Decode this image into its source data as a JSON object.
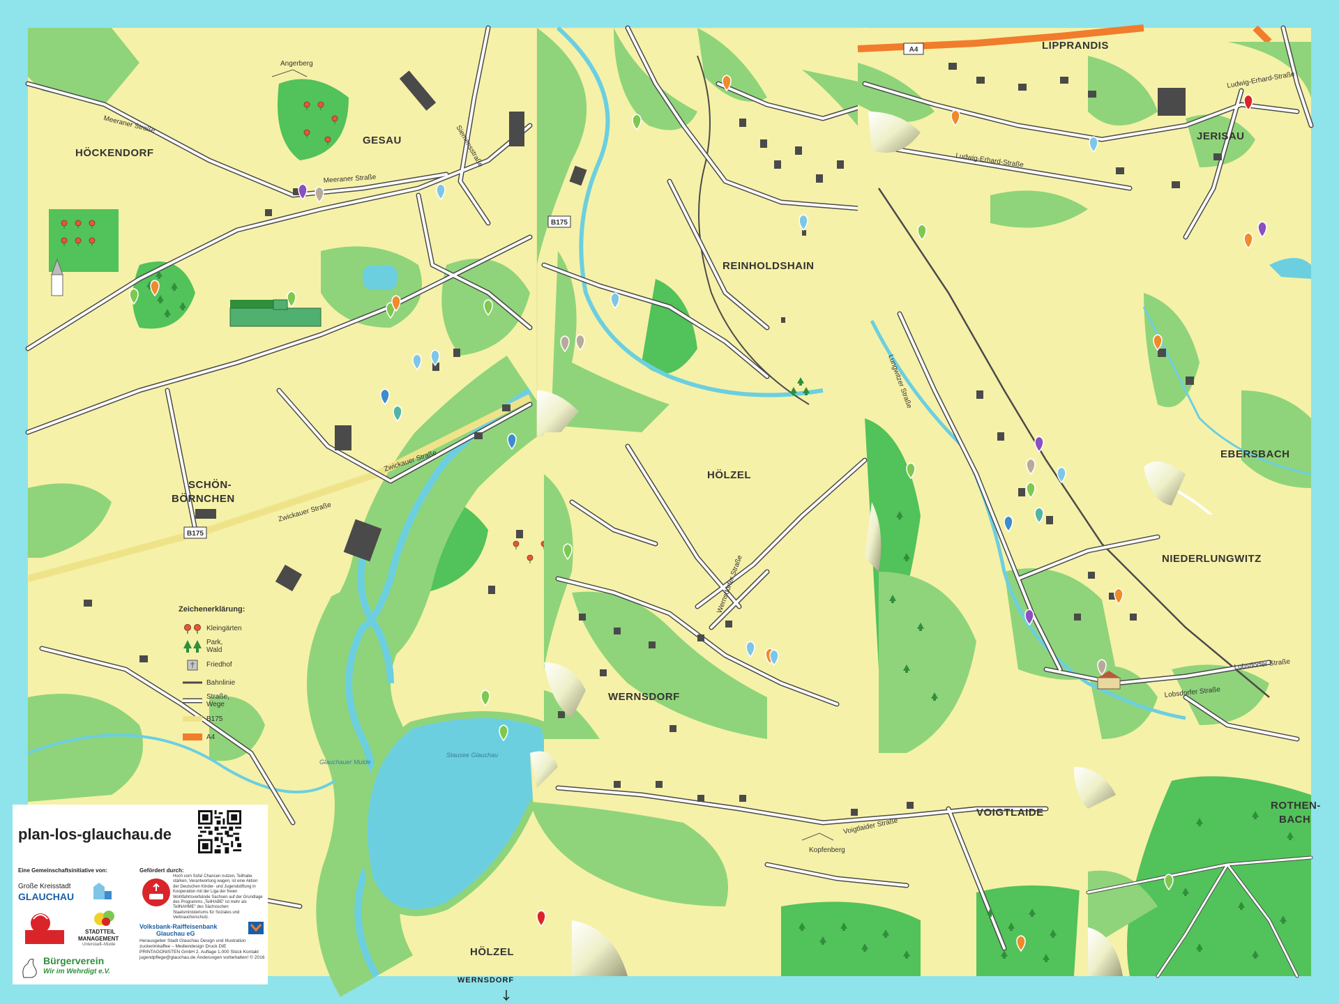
{
  "colors": {
    "frame": "#8fe3ea",
    "land": "#f6f1a8",
    "green": "#8fd47a",
    "forest": "#52c25a",
    "water": "#6ccfe0",
    "road": "#ffffff",
    "b175": "#efe38a",
    "a4": "#f07c2c",
    "building": "#4a4a4a",
    "pin_green": "#7ec850",
    "pin_orange": "#f08a2a",
    "pin_blue": "#7ec6e6",
    "pin_purple": "#8a4fc0",
    "pin_red": "#d9252a",
    "pin_grey": "#b8aa9a"
  },
  "places": {
    "hoeckendorf": "HÖCKENDORF",
    "gesau": "GESAU",
    "schoenboernchen_1": "SCHÖN-",
    "schoenboernchen_2": "BÖRNCHEN",
    "reinholdshain": "REINHOLDSHAIN",
    "hoelzel_n": "HÖLZEL",
    "wernsdorf": "WERNSDORF",
    "lipprandis": "LIPPRANDIS",
    "jerisau": "JERISAU",
    "ebersbach": "EBERSBACH",
    "niederlungwitz": "NIEDERLUNGWITZ",
    "voigtlaide": "VOIGTLAIDE",
    "rothenbach_1": "ROTHEN-",
    "rothenbach_2": "BACH",
    "hoelzel_s": "HÖLZEL",
    "wernsdorf_arrow": "WERNSDORF"
  },
  "streets": {
    "meeraner_strasse": "Meeraner Straße",
    "meeraner_strasse_2": "Meeraner Straße",
    "siemensstrasse": "Siemensstraße",
    "zwickauer_strasse": "Zwickauer Straße",
    "zwickauer_strasse_2": "Zwickauer Straße",
    "wernsdorfer_strasse": "Wernsdorfer Straße",
    "voigtlaider_strasse": "Voigtlaider Straße",
    "lobsdorfer_strasse": "Lobsdorfer Straße",
    "lobsdorfer_strasse_2": "Lobsdorfer Straße",
    "ludwig_erhard_strasse": "Ludwig-Erhard-Straße",
    "ludwig_erhard_strasse_2": "Ludwig-Erhard-Straße",
    "lungwitzer_strasse": "Lungwitzer Straße",
    "b175": "B175",
    "b175_2": "B175",
    "a4": "A4",
    "angerberg": "Angerberg",
    "kopfenberg": "Kopfenberg",
    "stausee": "Stausee Glauchau",
    "mulde": "Glauchauer Mulde"
  },
  "legend": {
    "title": "Zeichenerklärung:",
    "items": [
      {
        "label1": "Kleingärten",
        "label2": ""
      },
      {
        "label1": "Park,",
        "label2": "Wald"
      },
      {
        "label1": "Friedhof",
        "label2": ""
      },
      {
        "label1": "Bahnlinie",
        "label2": ""
      },
      {
        "label1": "Straße,",
        "label2": "Wege"
      },
      {
        "label1": "B175",
        "label2": ""
      },
      {
        "label1": "A4",
        "label2": ""
      }
    ]
  },
  "info": {
    "url": "plan-los-glauchau.de",
    "initiative_label": "Eine Gemeinschaftsinitiative von:",
    "funded_label": "Gefördert durch:",
    "org_city_1": "Große Kreisstadt",
    "org_city_2": "GLAUCHAU",
    "org_stadtteil_1": "STADTTEIL",
    "org_stadtteil_2": "MANAGEMENT",
    "org_stadtteil_3": "Unterstadt–Mulde",
    "org_verein_1": "Bürgerverein",
    "org_verein_2": "Wir im Wehrdigt e.V.",
    "funding_text": "Hoch vom Sofa! Chancen nutzen, Teilhabe stärken, Verantwortung wagen, ist eine Aktion der Deutschen Kinder- und Jugendstiftung in Kooperation mit der Liga der freien Wohlfahrtsverbände Sachsen auf der Grundlage des Programms „TeilHABE“ ist mehr als TeilNAHME“ des Sächsischen Staatsministeriums für Soziales und Verbraucherschutz.",
    "bank_1": "Volksbank-Raiffeisenbank",
    "bank_2": "Glauchau eG",
    "imprint": "Herausgeber Stadt Glauchau Design und Illustration zuckerimkaffee – Mediendesign Druck DIE PRINTAGONISTEN GmbH 2. Auflage 1.000 Stück Kontakt jugendpflege@glauchau.de Änderungen vorbehalten! © 2016"
  }
}
